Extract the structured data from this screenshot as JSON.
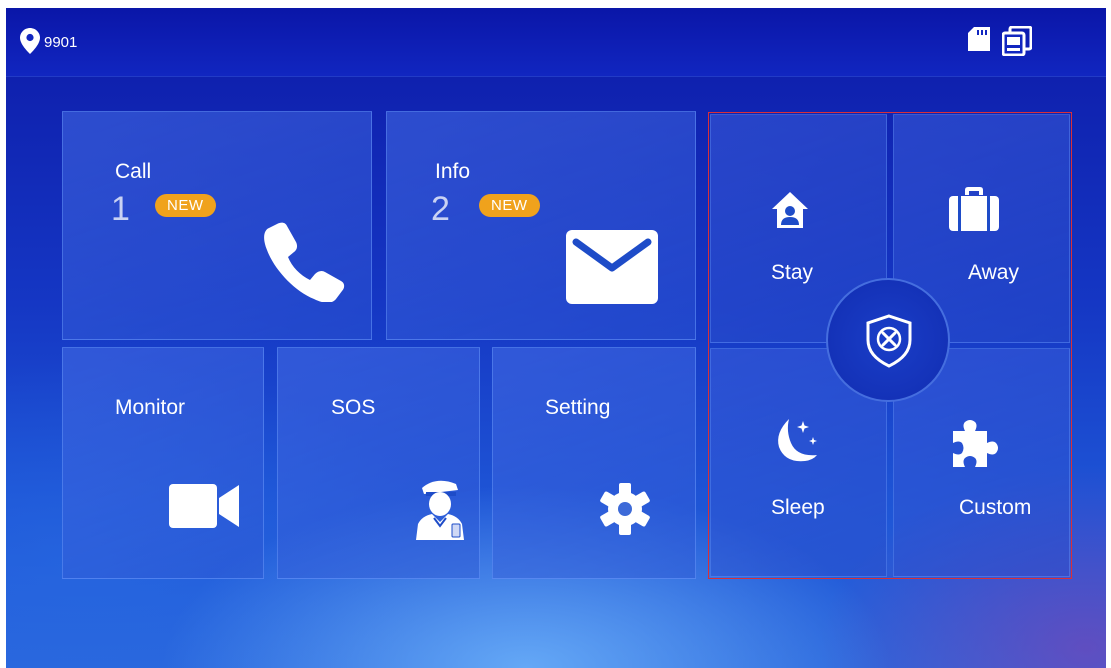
{
  "status_bar": {
    "room_number": "9901",
    "icons": {
      "location": "location-pin-icon",
      "sd_card": "sd-card-icon",
      "devices": "devices-icon"
    }
  },
  "tiles": {
    "call": {
      "label": "Call",
      "count": "1",
      "badge": "NEW",
      "icon": "phone-icon"
    },
    "info": {
      "label": "Info",
      "count": "2",
      "badge": "NEW",
      "icon": "envelope-icon"
    },
    "monitor": {
      "label": "Monitor",
      "icon": "video-camera-icon"
    },
    "sos": {
      "label": "SOS",
      "icon": "security-guard-icon"
    },
    "setting": {
      "label": "Setting",
      "icon": "gear-icon"
    }
  },
  "alarm": {
    "stay": {
      "label": "Stay",
      "icon": "home-person-icon"
    },
    "away": {
      "label": "Away",
      "icon": "briefcase-icon"
    },
    "sleep": {
      "label": "Sleep",
      "icon": "moon-stars-icon"
    },
    "custom": {
      "label": "Custom",
      "icon": "puzzle-icon"
    },
    "disarm": {
      "icon": "shield-x-icon"
    }
  },
  "colors": {
    "accent": "#f0a21c",
    "alarm_border": "#d8303a",
    "background": "#1537c4"
  }
}
